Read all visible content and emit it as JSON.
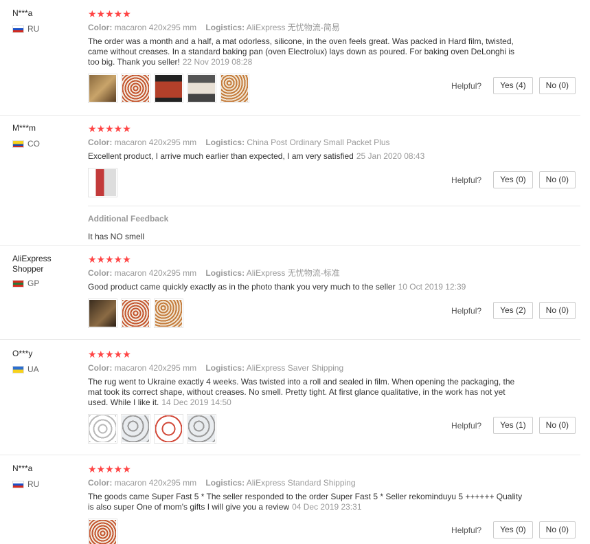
{
  "reviews": [
    {
      "user": "N***a",
      "country": "RU",
      "stars": "★★★★★",
      "color_label": "Color:",
      "color_value": "macaron 420x295 mm",
      "logistics_label": "Logistics:",
      "logistics_value": "AliExpress 无忧物流-简易",
      "text": "The order was a month and a half, a mat odorless, silicone, in the oven feels great. Was packed in Hard film, twisted, came without creases. In a standard baking pan (oven Electrolux) lays down as poured. For baking oven DeLonghi is too big. Thank you seller!",
      "date": "22 Nov 2019 08:28",
      "helpful_label": "Helpful?",
      "yes": "Yes (4)",
      "no": "No (0)"
    },
    {
      "user": "M***m",
      "country": "CO",
      "stars": "★★★★★",
      "color_label": "Color:",
      "color_value": "macaron 420x295 mm",
      "logistics_label": "Logistics:",
      "logistics_value": "China Post Ordinary Small Packet Plus",
      "text": "Excellent product, I arrive much earlier than expected, I am very satisfied",
      "date": "25 Jan 2020 08:43",
      "helpful_label": "Helpful?",
      "yes": "Yes (0)",
      "no": "No (0)",
      "additional_title": "Additional Feedback",
      "additional_text": "It has NO smell"
    },
    {
      "user": "AliExpress Shopper",
      "country": "GP",
      "stars": "★★★★★",
      "color_label": "Color:",
      "color_value": "macaron 420x295 mm",
      "logistics_label": "Logistics:",
      "logistics_value": "AliExpress 无忧物流-标准",
      "text": "Good product came quickly exactly as in the photo thank you very much to the seller",
      "date": "10 Oct 2019 12:39",
      "helpful_label": "Helpful?",
      "yes": "Yes (2)",
      "no": "No (0)"
    },
    {
      "user": "O***y",
      "country": "UA",
      "stars": "★★★★★",
      "color_label": "Color:",
      "color_value": "macaron 420x295 mm",
      "logistics_label": "Logistics:",
      "logistics_value": "AliExpress Saver Shipping",
      "text": "The rug went to Ukraine exactly 4 weeks. Was twisted into a roll and sealed in film. When opening the packaging, the mat took its correct shape, without creases. No smell. Pretty tight. At first glance qualitative, in the work has not yet used. While I like it.",
      "date": "14 Dec 2019 14:50",
      "helpful_label": "Helpful?",
      "yes": "Yes (1)",
      "no": "No (0)"
    },
    {
      "user": "N***a",
      "country": "RU",
      "stars": "★★★★★",
      "color_label": "Color:",
      "color_value": "macaron 420x295 mm",
      "logistics_label": "Logistics:",
      "logistics_value": "AliExpress Standard Shipping",
      "text": "The goods came Super Fast 5 * The seller responded to the order Super Fast 5 * Seller rekominduyu 5 ++++++ Quality is also super One of mom's gifts I will give you a review",
      "date": "04 Dec 2019 23:31",
      "helpful_label": "Helpful?",
      "yes": "Yes (0)",
      "no": "No (0)"
    }
  ],
  "colors": {
    "star": "#ff4444",
    "muted": "#999999",
    "border": "#e8e8e8"
  }
}
